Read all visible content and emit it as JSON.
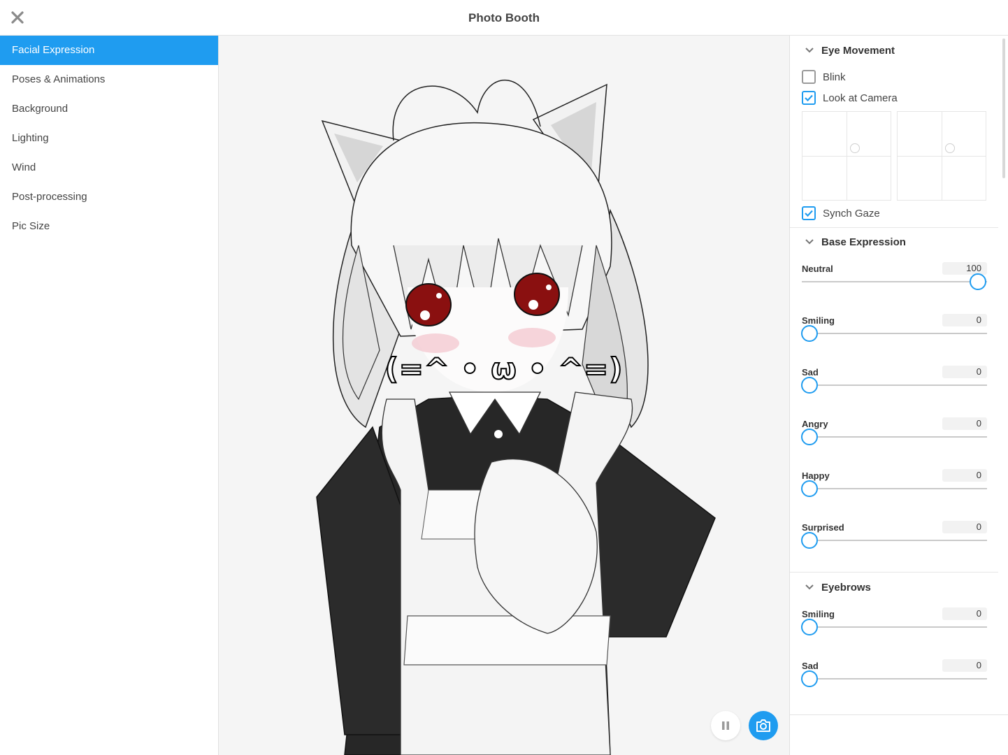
{
  "header": {
    "title": "Photo Booth"
  },
  "sidebar": {
    "items": [
      {
        "label": "Facial Expression"
      },
      {
        "label": "Poses & Animations"
      },
      {
        "label": "Background"
      },
      {
        "label": "Lighting"
      },
      {
        "label": "Wind"
      },
      {
        "label": "Post-processing"
      },
      {
        "label": "Pic Size"
      }
    ]
  },
  "viewport": {
    "kaomoji": "(=^ • ω • ^=)"
  },
  "panel": {
    "eye_movement": {
      "title": "Eye Movement",
      "blink": {
        "label": "Blink",
        "checked": false
      },
      "look_at_camera": {
        "label": "Look at Camera",
        "checked": true
      },
      "synch_gaze": {
        "label": "Synch Gaze",
        "checked": true
      }
    },
    "base_expression": {
      "title": "Base Expression",
      "sliders": [
        {
          "label": "Neutral",
          "value": "100",
          "fraction": 1.0
        },
        {
          "label": "Smiling",
          "value": "0",
          "fraction": 0.0
        },
        {
          "label": "Sad",
          "value": "0",
          "fraction": 0.0
        },
        {
          "label": "Angry",
          "value": "0",
          "fraction": 0.0
        },
        {
          "label": "Happy",
          "value": "0",
          "fraction": 0.0
        },
        {
          "label": "Surprised",
          "value": "0",
          "fraction": 0.0
        }
      ]
    },
    "eyebrows": {
      "title": "Eyebrows",
      "sliders": [
        {
          "label": "Smiling",
          "value": "0",
          "fraction": 0.0
        },
        {
          "label": "Sad",
          "value": "0",
          "fraction": 0.0
        }
      ]
    }
  },
  "colors": {
    "accent": "#1f9cf0",
    "sidebar_active": "#1f9cf0"
  }
}
